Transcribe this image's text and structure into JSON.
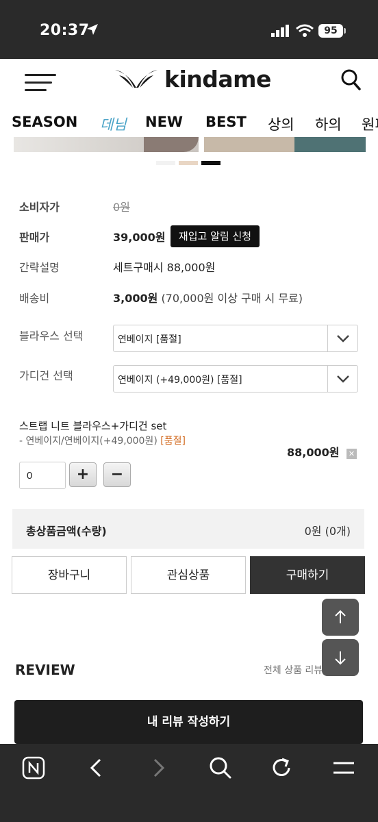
{
  "status_bar": {
    "time": "20:37",
    "battery": "95"
  },
  "header": {
    "brand": "kindame"
  },
  "categories": [
    {
      "label": "SEASON"
    },
    {
      "label": "데님"
    },
    {
      "label": "NEW"
    },
    {
      "label": "BEST"
    },
    {
      "label": "상의"
    },
    {
      "label": "하의"
    },
    {
      "label": "원피"
    }
  ],
  "product": {
    "rows": [
      {
        "label": "소비자가",
        "value": "0원"
      },
      {
        "label": "판매가",
        "value": "39,000원"
      },
      {
        "label": "간략설명",
        "value": "세트구매시 88,000원"
      },
      {
        "label": "배송비",
        "value_bold": "3,000원",
        "value_note": "(70,000원 이상 구매 시 무료)"
      }
    ],
    "restock_button": "재입고 알림 신청",
    "selects": [
      {
        "label": "블라우스 선택",
        "value": "연베이지 [품절]"
      },
      {
        "label": "가디건 선택",
        "value": "연베이지 (+49,000원) [품절]"
      }
    ],
    "selected_option": {
      "name": "스트랩 니트 블라우스+가디건 set",
      "detail": "- 연베이지/연베이지(+49,000원)",
      "status": "[품절]",
      "price": "88,000원",
      "quantity": "0"
    },
    "total": {
      "label": "총상품금액(수량)",
      "value": "0원 (0개)"
    },
    "actions": {
      "cart": "장바구니",
      "wishlist": "관심상품",
      "buy": "구매하기"
    }
  },
  "review": {
    "title": "REVIEW",
    "all_link": "전체 상품 리뷰",
    "write_button": "내 리뷰 작성하기"
  },
  "colors": {
    "accent_category": "#4aa3c7",
    "soldout": "#d2691e",
    "dark": "#1e1e1e"
  }
}
